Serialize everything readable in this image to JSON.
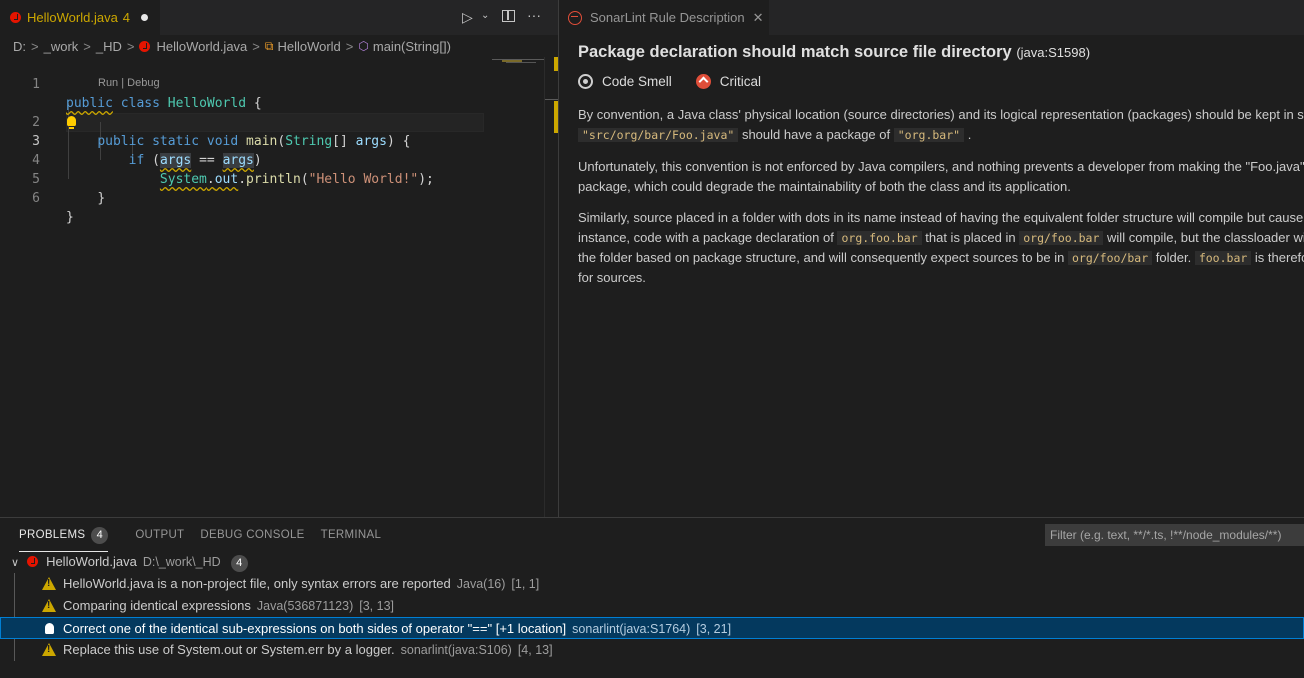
{
  "left_editor": {
    "tab": {
      "filename": "HelloWorld.java",
      "problem_count": "4"
    },
    "breadcrumb": [
      "D:",
      "_work",
      "_HD",
      "HelloWorld.java",
      "HelloWorld",
      "main(String[])"
    ],
    "codelens": "Run | Debug",
    "line_numbers": [
      "1",
      "2",
      "3",
      "4",
      "5",
      "6"
    ]
  },
  "right_editor": {
    "tab_label": "SonarLint Rule Description",
    "rule": {
      "title": "Package declaration should match source file directory",
      "key": "(java:S1598)",
      "type": "Code Smell",
      "severity": "Critical",
      "p1": {
        "a": "By convention, a Java class' physical location (source directories) and its logical representation (packages) should be kept in sync. Thus a Java file located at",
        "code1": "\"src/org/bar/Foo.java\"",
        "b": "should have a package of",
        "code2": "\"org.bar\"",
        "c": "."
      },
      "p2": {
        "line1": "Unfortunately, this convention is not enforced by Java compilers, and nothing prevents a developer from making the \"Foo.java\" class part of the \"com.apple\"",
        "line2": "package, which could degrade the maintainability of both the class and its application."
      },
      "p3": {
        "line1": "Similarly, source placed in a folder with dots in its name instead of having the equivalent folder structure will compile but cause problems at run time. For",
        "a": "instance, code with a package declaration of",
        "code1": "org.foo.bar",
        "b": "that is placed in",
        "code2": "org/foo.bar",
        "c": "will compile, but the classloader will always search for the class into",
        "d": "the folder based on package structure, and will consequently expect sources to be in",
        "code3": "org/foo/bar",
        "e": "folder.",
        "code4": "foo.bar",
        "f": "is therefore not a proper folder name",
        "line4": "for sources."
      }
    }
  },
  "panel": {
    "tabs": [
      "PROBLEMS",
      "OUTPUT",
      "DEBUG CONSOLE",
      "TERMINAL"
    ],
    "problems_count": "4",
    "filter_placeholder": "Filter (e.g. text, **/*.ts, !**/node_modules/**)",
    "file": {
      "name": "HelloWorld.java",
      "path": "D:\\_work\\_HD",
      "count": "4"
    },
    "problems": [
      {
        "severity": "warning",
        "message": "HelloWorld.java is a non-project file, only syntax errors are reported",
        "source": "Java(16)",
        "pos": "[1, 1]"
      },
      {
        "severity": "warning",
        "message": "Comparing identical expressions",
        "source": "Java(536871123)",
        "pos": "[3, 13]"
      },
      {
        "severity": "info",
        "message": "Correct one of the identical sub-expressions on both sides of operator \"==\" [+1 location]",
        "source": "sonarlint(java:S1764)",
        "pos": "[3, 21]"
      },
      {
        "severity": "warning",
        "message": "Replace this use of System.out or System.err by a logger.",
        "source": "sonarlint(java:S106)",
        "pos": "[4, 13]"
      }
    ]
  }
}
